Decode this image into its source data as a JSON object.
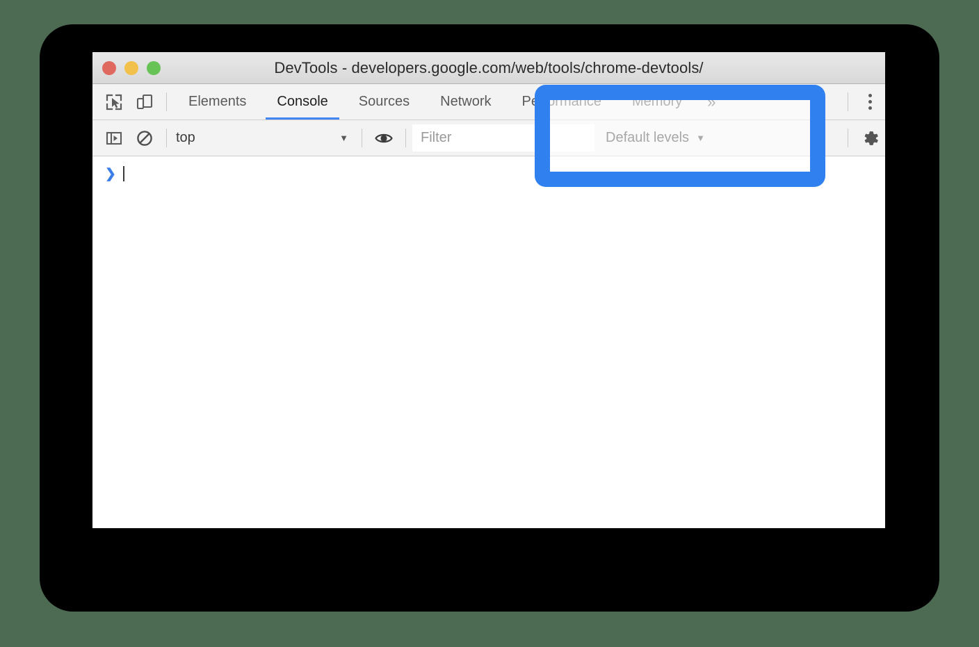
{
  "window": {
    "title": "DevTools - developers.google.com/web/tools/chrome-devtools/",
    "traffic_lights": [
      {
        "name": "close",
        "color": "#e0695f"
      },
      {
        "name": "minimize",
        "color": "#f2c14b"
      },
      {
        "name": "zoom",
        "color": "#68c357"
      }
    ]
  },
  "tabbar": {
    "inspect_icon": "inspect-element-icon",
    "device_icon": "device-toolbar-icon",
    "tabs": [
      {
        "label": "Elements",
        "active": false
      },
      {
        "label": "Console",
        "active": true
      },
      {
        "label": "Sources",
        "active": false
      },
      {
        "label": "Network",
        "active": false
      },
      {
        "label": "Performance",
        "active": false
      },
      {
        "label": "Memory",
        "active": false
      }
    ],
    "more_tabs_label": "»",
    "menu_icon": "more-vertical-icon"
  },
  "consolebar": {
    "sidebar_toggle_icon": "console-sidebar-icon",
    "clear_icon": "clear-console-icon",
    "context_value": "top",
    "context_caret": "▼",
    "eye_icon": "live-expression-eye-icon",
    "filter_placeholder": "Filter",
    "filter_value": "",
    "levels_label": "Default levels",
    "levels_caret": "▼",
    "settings_icon": "settings-gear-icon"
  },
  "console": {
    "prompt_chevron": "❯"
  },
  "callout": {
    "name": "log-level-highlight",
    "color": "#3080f0"
  },
  "colors": {
    "desktop": "#4d6b53",
    "frame": "#000000",
    "accent_blue": "#4285f4",
    "highlight_blue": "#3080f0"
  }
}
